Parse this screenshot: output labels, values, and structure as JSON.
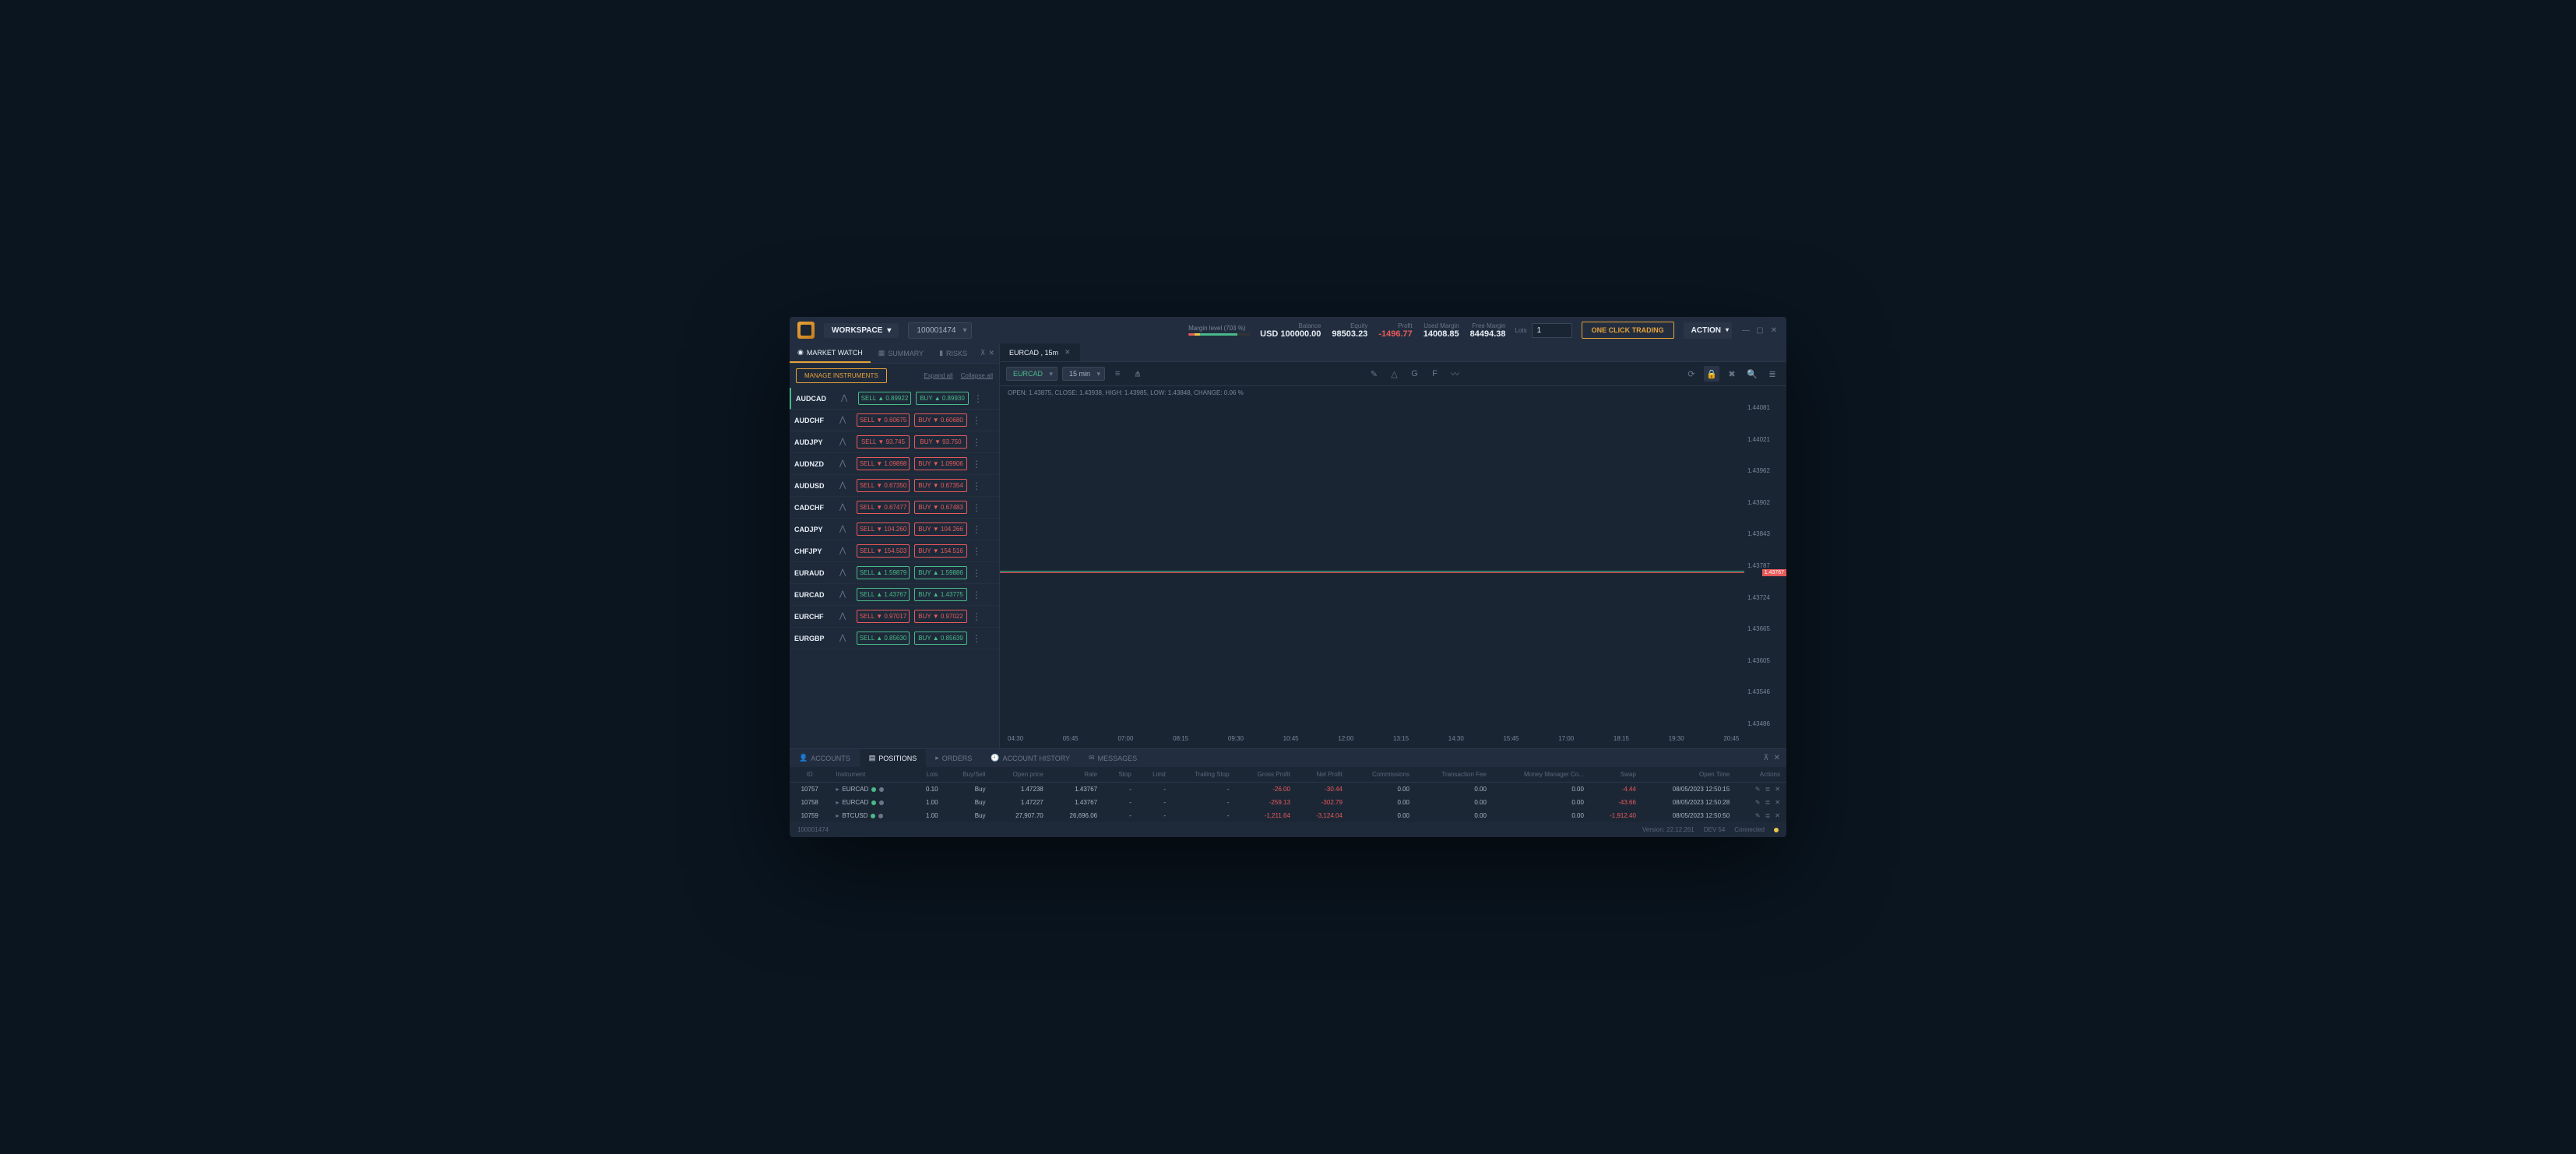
{
  "header": {
    "workspace_label": "WORKSPACE",
    "account_id": "100001474",
    "margin_level_label": "Margin level (703 %)",
    "stats": {
      "balance_label": "Balance",
      "balance_value": "100000.00",
      "balance_currency": "USD",
      "equity_label": "Equity",
      "equity_value": "98503.23",
      "profit_label": "Profit",
      "profit_value": "-1496.77",
      "used_margin_label": "Used Margin",
      "used_margin_value": "14008.85",
      "free_margin_label": "Free Margin",
      "free_margin_value": "84494.38"
    },
    "lots_label": "Lots",
    "lots_value": "1",
    "one_click_label": "ONE CLICK TRADING",
    "action_label": "ACTION"
  },
  "left_panel": {
    "tabs": {
      "market_watch": "MARKET WATCH",
      "summary": "SUMMARY",
      "risks": "RISKS"
    },
    "manage_label": "MANAGE INSTRUMENTS",
    "expand_label": "Expand all",
    "collapse_label": "Collapse all",
    "instruments": [
      {
        "symbol": "AUDCAD",
        "sell": "SELL ▲ 0.89922",
        "buy": "BUY ▲ 0.89930",
        "dir": "up"
      },
      {
        "symbol": "AUDCHF",
        "sell": "SELL ▼ 0.60675",
        "buy": "BUY ▼ 0.60680",
        "dir": "down"
      },
      {
        "symbol": "AUDJPY",
        "sell": "SELL ▼ 93.745",
        "buy": "BUY ▼ 93.750",
        "dir": "down"
      },
      {
        "symbol": "AUDNZD",
        "sell": "SELL ▼ 1.09898",
        "buy": "BUY ▼ 1.09906",
        "dir": "down"
      },
      {
        "symbol": "AUDUSD",
        "sell": "SELL ▼ 0.67350",
        "buy": "BUY ▼ 0.67354",
        "dir": "down"
      },
      {
        "symbol": "CADCHF",
        "sell": "SELL ▼ 0.67477",
        "buy": "BUY ▼ 0.67483",
        "dir": "down"
      },
      {
        "symbol": "CADJPY",
        "sell": "SELL ▼ 104.260",
        "buy": "BUY ▼ 104.266",
        "dir": "down"
      },
      {
        "symbol": "CHFJPY",
        "sell": "SELL ▼ 154.503",
        "buy": "BUY ▼ 154.516",
        "dir": "down"
      },
      {
        "symbol": "EURAUD",
        "sell": "SELL ▲ 1.59879",
        "buy": "BUY ▲ 1.59886",
        "dir": "up"
      },
      {
        "symbol": "EURCAD",
        "sell": "SELL ▲ 1.43767",
        "buy": "BUY ▲ 1.43775",
        "dir": "up"
      },
      {
        "symbol": "EURCHF",
        "sell": "SELL ▼ 0.97017",
        "buy": "BUY ▼ 0.97022",
        "dir": "down"
      },
      {
        "symbol": "EURGBP",
        "sell": "SELL ▲ 0.85630",
        "buy": "BUY ▲ 0.85639",
        "dir": "up"
      }
    ]
  },
  "chart": {
    "tab_title": "EURCAD , 15m",
    "symbol_sel": "EURCAD",
    "timeframe_sel": "15 min",
    "info_line": "OPEN: 1.43875, CLOSE: 1.43938, HIGH: 1.43985, LOW: 1.43848, CHANGE: 0.06 %",
    "yaxis": [
      "1.44081",
      "1.44021",
      "1.43962",
      "1.43902",
      "1.43843",
      "1.43787",
      "1.43724",
      "1.43665",
      "1.43605",
      "1.43546",
      "1.43486"
    ],
    "xaxis": [
      "04:30",
      "05:45",
      "07:00",
      "08:15",
      "09:30",
      "10:45",
      "12:00",
      "13:15",
      "14:30",
      "15:45",
      "17:00",
      "18:15",
      "19:30",
      "20:45"
    ],
    "price_tag": "1.43767"
  },
  "bottom": {
    "tabs": {
      "accounts": "ACCOUNTS",
      "positions": "POSITIONS",
      "orders": "ORDERS",
      "account_history": "ACCOUNT HISTORY",
      "messages": "MESSAGES"
    },
    "headers": [
      "ID",
      "Instrument",
      "Lots",
      "Buy/Sell",
      "Open price",
      "Rate",
      "Stop",
      "Limit",
      "Trailing Stop",
      "Gross Profit",
      "Net Profit",
      "Commissions",
      "Transaction Fee",
      "Money Manager Co...",
      "Swap",
      "Open Time",
      "Actions"
    ],
    "rows": [
      {
        "id": "10757",
        "instr": "EURCAD",
        "lots": "0.10",
        "side": "Buy",
        "open": "1.47238",
        "rate": "1.43767",
        "stop": "-",
        "limit": "-",
        "ts": "-",
        "gross": "-26.00",
        "net": "-30.44",
        "comm": "0.00",
        "fee": "0.00",
        "mm": "0.00",
        "swap": "-4.44",
        "time": "08/05/2023 12:50:15"
      },
      {
        "id": "10758",
        "instr": "EURCAD",
        "lots": "1.00",
        "side": "Buy",
        "open": "1.47227",
        "rate": "1.43767",
        "stop": "-",
        "limit": "-",
        "ts": "-",
        "gross": "-259.13",
        "net": "-302.79",
        "comm": "0.00",
        "fee": "0.00",
        "mm": "0.00",
        "swap": "-43.66",
        "time": "08/05/2023 12:50:28"
      },
      {
        "id": "10759",
        "instr": "BTCUSD",
        "lots": "1.00",
        "side": "Buy",
        "open": "27,907.70",
        "rate": "26,696.06",
        "stop": "-",
        "limit": "-",
        "ts": "-",
        "gross": "-1,211.64",
        "net": "-3,124.04",
        "comm": "0.00",
        "fee": "0.00",
        "mm": "0.00",
        "swap": "-1,912.40",
        "time": "08/05/2023 12:50:50"
      }
    ]
  },
  "status": {
    "left": "100001474",
    "version": "Version: 22.12.261",
    "env": "DEV 54",
    "connected": "Connected"
  }
}
